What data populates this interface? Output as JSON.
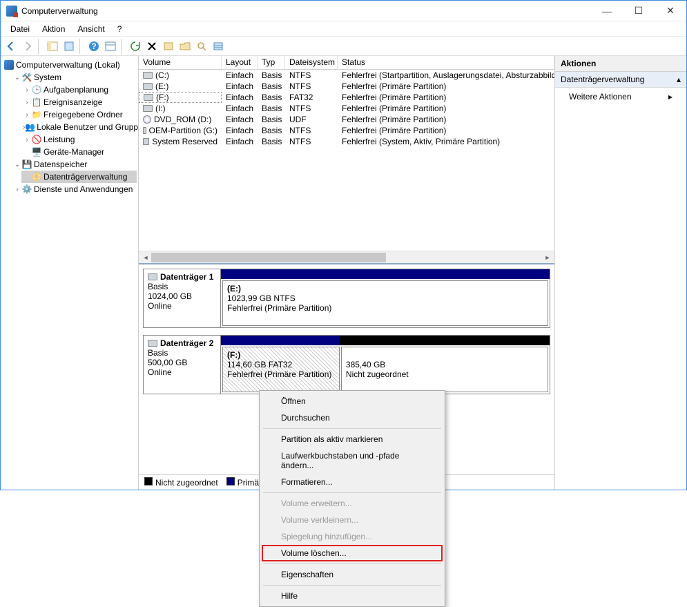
{
  "window": {
    "title": "Computerverwaltung"
  },
  "menu": {
    "file": "Datei",
    "action": "Aktion",
    "view": "Ansicht",
    "help": "?"
  },
  "tree": {
    "root": "Computerverwaltung (Lokal)",
    "system": "System",
    "taskScheduler": "Aufgabenplanung",
    "eventViewer": "Ereignisanzeige",
    "sharedFolders": "Freigegebene Ordner",
    "localUsers": "Lokale Benutzer und Gruppen",
    "performance": "Leistung",
    "deviceManager": "Geräte-Manager",
    "storage": "Datenspeicher",
    "diskMgmt": "Datenträgerverwaltung",
    "services": "Dienste und Anwendungen"
  },
  "columns": {
    "volume": "Volume",
    "layout": "Layout",
    "type": "Typ",
    "fs": "Dateisystem",
    "status": "Status"
  },
  "volumes": [
    {
      "name": "(C:)",
      "layout": "Einfach",
      "type": "Basis",
      "fs": "NTFS",
      "status": "Fehlerfrei (Startpartition, Auslagerungsdatei, Absturzabbild)",
      "icon": "disk"
    },
    {
      "name": "(E:)",
      "layout": "Einfach",
      "type": "Basis",
      "fs": "NTFS",
      "status": "Fehlerfrei (Primäre Partition)",
      "icon": "disk"
    },
    {
      "name": "(F:)",
      "layout": "Einfach",
      "type": "Basis",
      "fs": "FAT32",
      "status": "Fehlerfrei (Primäre Partition)",
      "icon": "disk",
      "selected": true
    },
    {
      "name": "(I:)",
      "layout": "Einfach",
      "type": "Basis",
      "fs": "NTFS",
      "status": "Fehlerfrei (Primäre Partition)",
      "icon": "disk"
    },
    {
      "name": "DVD_ROM (D:)",
      "layout": "Einfach",
      "type": "Basis",
      "fs": "UDF",
      "status": "Fehlerfrei (Primäre Partition)",
      "icon": "cd"
    },
    {
      "name": "OEM-Partition (G:)",
      "layout": "Einfach",
      "type": "Basis",
      "fs": "NTFS",
      "status": "Fehlerfrei (Primäre Partition)",
      "icon": "disk"
    },
    {
      "name": "System Reserved",
      "layout": "Einfach",
      "type": "Basis",
      "fs": "NTFS",
      "status": "Fehlerfrei (System, Aktiv, Primäre Partition)",
      "icon": "disk"
    }
  ],
  "disks": {
    "d1": {
      "title": "Datenträger 1",
      "type": "Basis",
      "size": "1024,00 GB",
      "status": "Online",
      "part": {
        "name": "(E:)",
        "info": "1023,99 GB NTFS",
        "status": "Fehlerfrei (Primäre Partition)"
      }
    },
    "d2": {
      "title": "Datenträger 2",
      "type": "Basis",
      "size": "500,00 GB",
      "status": "Online",
      "p1": {
        "name": "(F:)",
        "info": "114,60 GB FAT32",
        "status": "Fehlerfrei (Primäre Partition)"
      },
      "p2": {
        "info": "385,40 GB",
        "status": "Nicht zugeordnet"
      }
    }
  },
  "legend": {
    "unallocated": "Nicht zugeordnet",
    "primary": "Primäre Partition"
  },
  "actions": {
    "title": "Aktionen",
    "section": "Datenträgerverwaltung",
    "more": "Weitere Aktionen"
  },
  "ctx": {
    "open": "Öffnen",
    "browse": "Durchsuchen",
    "markActive": "Partition als aktiv markieren",
    "changeLetter": "Laufwerkbuchstaben und -pfade ändern...",
    "format": "Formatieren...",
    "extend": "Volume erweitern...",
    "shrink": "Volume verkleinern...",
    "mirror": "Spiegelung hinzufügen...",
    "delete": "Volume löschen...",
    "props": "Eigenschaften",
    "help": "Hilfe"
  }
}
